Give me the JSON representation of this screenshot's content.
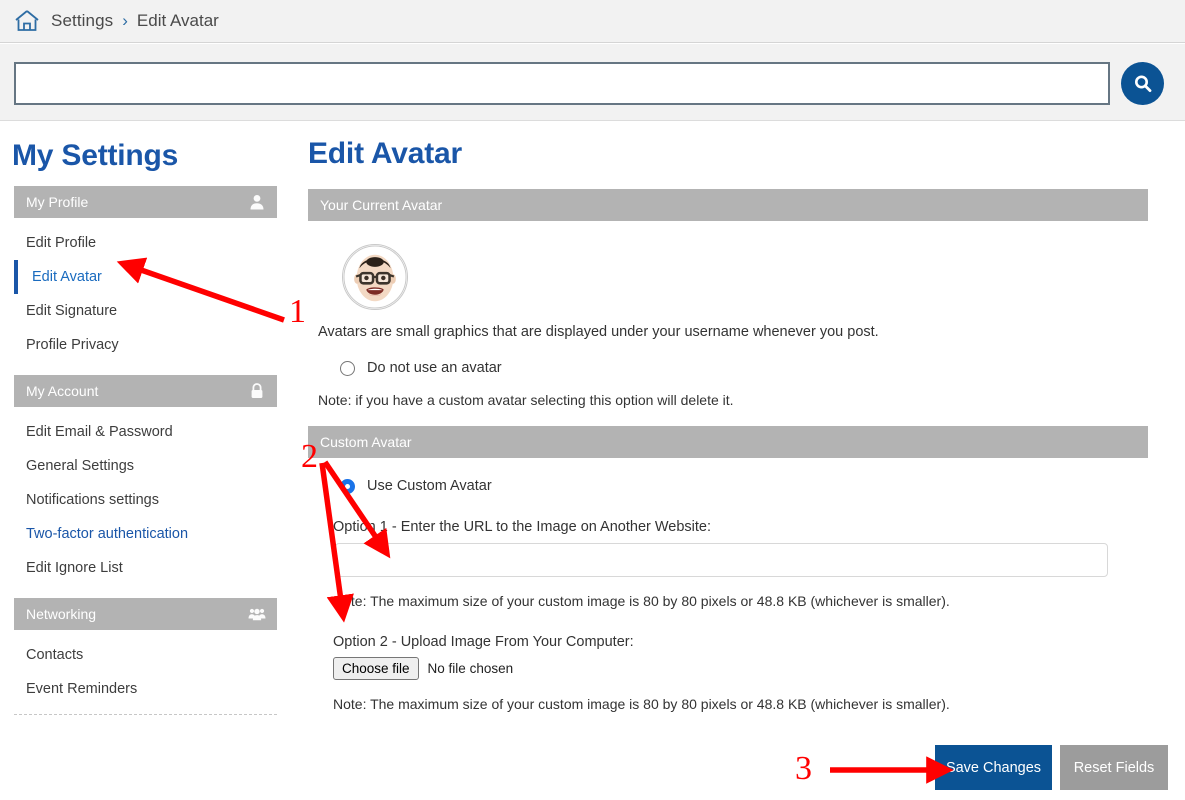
{
  "breadcrumb": {
    "home_icon": "home-icon",
    "items": [
      "Settings",
      "Edit Avatar"
    ],
    "separator": "›"
  },
  "search": {
    "value": "",
    "placeholder": "",
    "button_icon": "search-icon"
  },
  "sidebar": {
    "title": "My Settings",
    "groups": [
      {
        "label": "My Profile",
        "icon": "person-icon",
        "items": [
          {
            "label": "Edit Profile",
            "active": false,
            "style": "normal"
          },
          {
            "label": "Edit Avatar",
            "active": true,
            "style": "normal"
          },
          {
            "label": "Edit Signature",
            "active": false,
            "style": "normal"
          },
          {
            "label": "Profile Privacy",
            "active": false,
            "style": "normal"
          }
        ]
      },
      {
        "label": "My Account",
        "icon": "lock-icon",
        "items": [
          {
            "label": "Edit Email & Password",
            "active": false,
            "style": "normal"
          },
          {
            "label": "General Settings",
            "active": false,
            "style": "normal"
          },
          {
            "label": "Notifications settings",
            "active": false,
            "style": "normal"
          },
          {
            "label": "Two-factor authentication",
            "active": false,
            "style": "link"
          },
          {
            "label": "Edit Ignore List",
            "active": false,
            "style": "normal"
          }
        ]
      },
      {
        "label": "Networking",
        "icon": "people-group-icon",
        "items": [
          {
            "label": "Contacts",
            "active": false,
            "style": "normal"
          },
          {
            "label": "Event Reminders",
            "active": false,
            "style": "normal"
          }
        ]
      }
    ]
  },
  "main": {
    "title": "Edit Avatar",
    "current_avatar": {
      "header": "Your Current Avatar",
      "avatar_alt": "user-avatar",
      "description": "Avatars are small graphics that are displayed under your username whenever you post.",
      "no_avatar_option": {
        "label": "Do not use an avatar",
        "checked": false
      },
      "no_avatar_note": "Note: if you have a custom avatar selecting this option will delete it."
    },
    "custom_avatar": {
      "header": "Custom Avatar",
      "use_custom_option": {
        "label": "Use Custom Avatar",
        "checked": true
      },
      "option1_label": "Option 1 - Enter the URL to the Image on Another Website:",
      "url_value": "",
      "url_placeholder": "",
      "option1_note": "Note: The maximum size of your custom image is 80 by 80 pixels or 48.8 KB (whichever is smaller).",
      "option2_label": "Option 2 - Upload Image From Your Computer:",
      "choose_file_label": "Choose file",
      "file_status": "No file chosen",
      "option2_note": "Note: The maximum size of your custom image is 80 by 80 pixels or 48.8 KB (whichever is smaller)."
    }
  },
  "footer": {
    "save_label": "Save Changes",
    "reset_label": "Reset Fields"
  },
  "annotations": {
    "markers": [
      "1",
      "2",
      "3"
    ],
    "color": "#ff0000"
  },
  "colors": {
    "brand_blue": "#1a56a8",
    "button_blue": "#0b5394",
    "section_gray": "#b3b3b3",
    "reset_gray": "#9c9c9c",
    "annotation_red": "#ff0000"
  }
}
